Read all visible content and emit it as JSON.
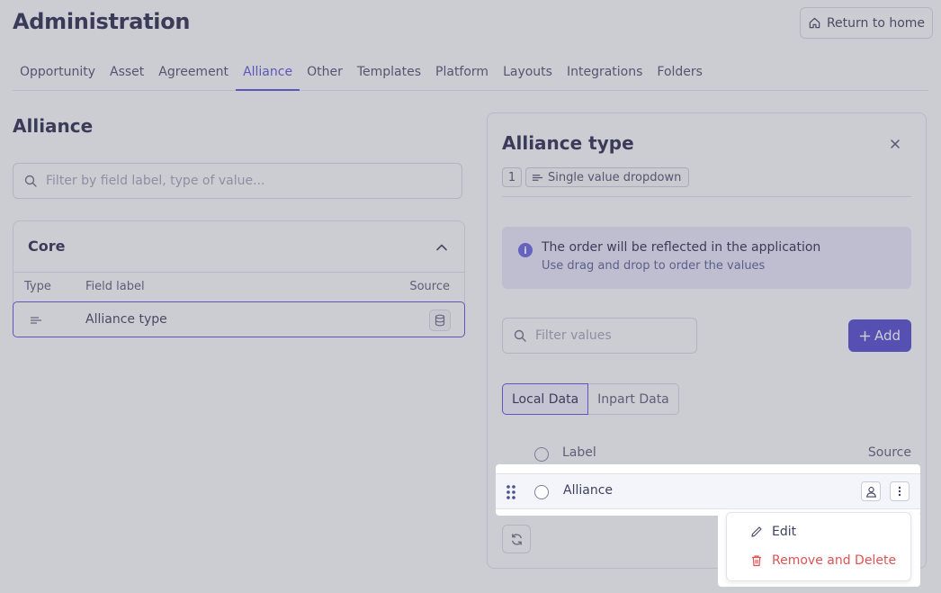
{
  "header": {
    "title": "Administration",
    "return_label": "Return to home"
  },
  "tabs": [
    {
      "label": "Opportunity"
    },
    {
      "label": "Asset"
    },
    {
      "label": "Agreement"
    },
    {
      "label": "Alliance",
      "active": true
    },
    {
      "label": "Other"
    },
    {
      "label": "Templates"
    },
    {
      "label": "Platform"
    },
    {
      "label": "Layouts"
    },
    {
      "label": "Integrations"
    },
    {
      "label": "Folders"
    }
  ],
  "left": {
    "title": "Alliance",
    "filter_placeholder": "Filter by field label, type of value...",
    "section": {
      "title": "Core",
      "columns": {
        "type": "Type",
        "label": "Field label",
        "source": "Source"
      },
      "rows": [
        {
          "label": "Alliance type",
          "type_icon": "list-icon",
          "source_icon": "database-icon"
        }
      ]
    }
  },
  "panel": {
    "title": "Alliance type",
    "count": "1",
    "type_label": "Single value dropdown",
    "info": {
      "title": "The order will be reflected in the application",
      "subtitle": "Use drag and drop to order the values"
    },
    "filter_placeholder": "Filter values",
    "add_label": "Add",
    "segments": [
      {
        "label": "Local Data",
        "active": true
      },
      {
        "label": "Inpart Data"
      }
    ],
    "list_columns": {
      "label": "Label",
      "source": "Source"
    },
    "values": [
      {
        "label": "Alliance",
        "source_icon": "user-icon"
      }
    ],
    "context_menu": {
      "edit_label": "Edit",
      "delete_label": "Remove and Delete"
    }
  },
  "colors": {
    "accent": "#4b44d6",
    "primary_button": "#3f37c9",
    "danger": "#e05252",
    "info_bg": "#e9e8fb"
  }
}
